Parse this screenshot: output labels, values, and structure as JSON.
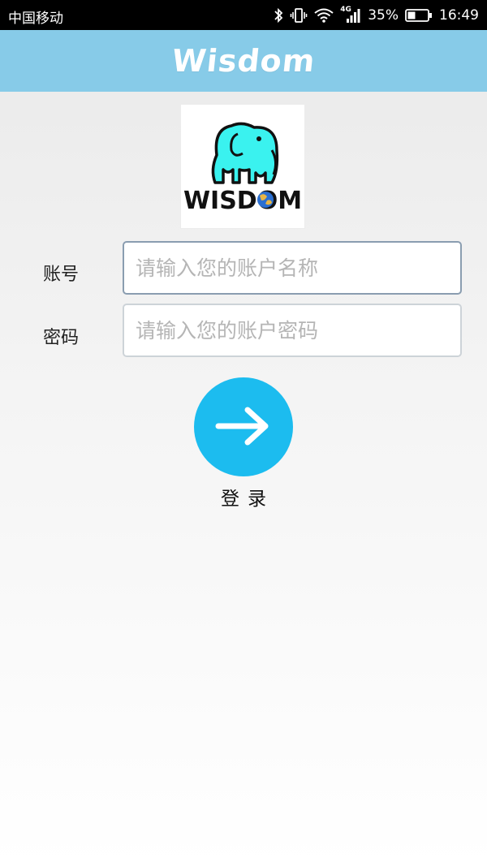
{
  "status_bar": {
    "carrier": "中国移动",
    "network": "4G",
    "battery": "35%",
    "time": "16:49"
  },
  "header": {
    "title": "Wisdom"
  },
  "logo": {
    "text": "WISDOM",
    "icon": "elephant-icon",
    "color": "#3af2ef"
  },
  "form": {
    "account_label": "账号",
    "account_placeholder": "请输入您的账户名称",
    "password_label": "密码",
    "password_placeholder": "请输入您的账户密码"
  },
  "login": {
    "icon": "arrow-right-icon",
    "label": "登录",
    "color": "#1cbcef"
  },
  "colors": {
    "header_bg": "#87cbe8",
    "status_bg": "#000000"
  }
}
